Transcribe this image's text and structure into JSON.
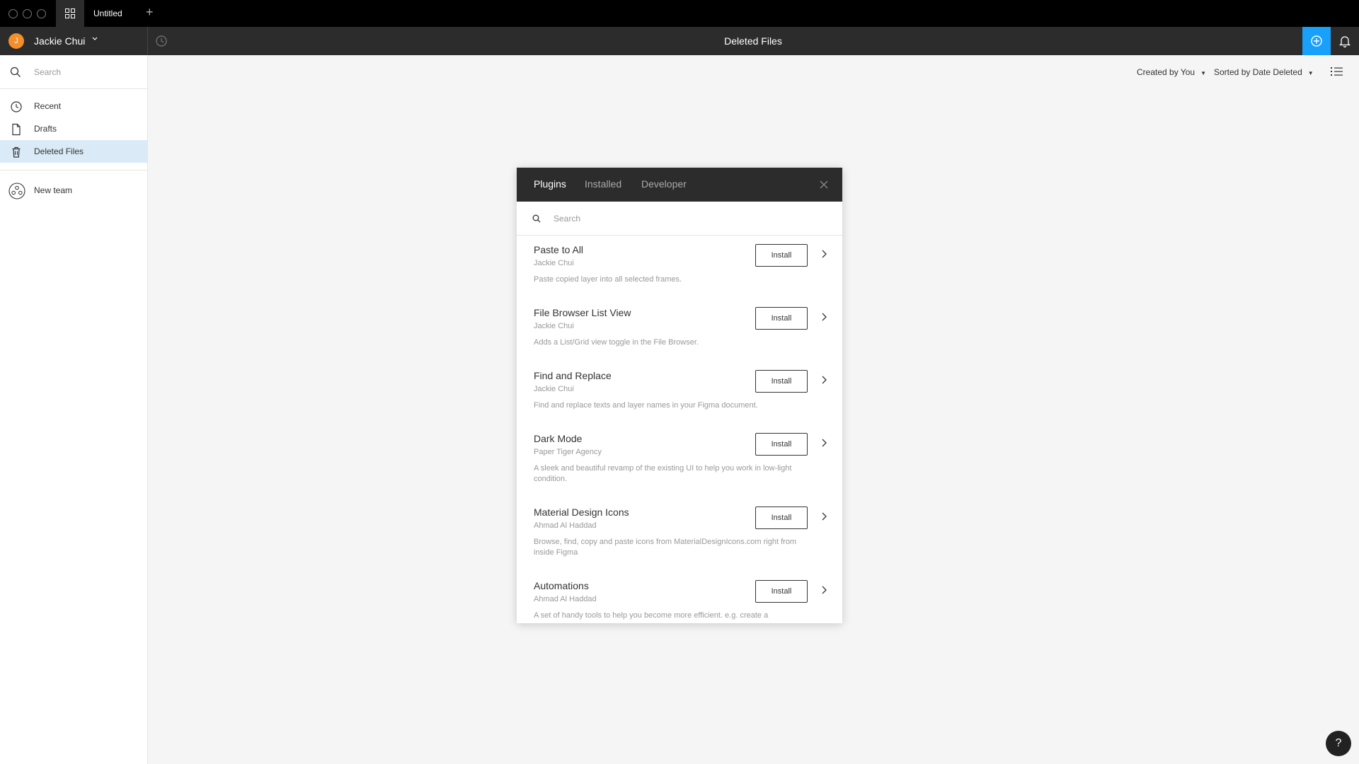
{
  "window": {
    "tab_title": "Untitled",
    "new_tab_symbol": "+"
  },
  "topbar": {
    "avatar_initial": "J",
    "user_name": "Jackie Chui",
    "page_title": "Deleted Files"
  },
  "sidebar": {
    "search_placeholder": "Search",
    "items": [
      {
        "label": "Recent",
        "icon": "clock-icon"
      },
      {
        "label": "Drafts",
        "icon": "file-icon"
      },
      {
        "label": "Deleted Files",
        "icon": "trash-icon",
        "active": true
      }
    ],
    "team": {
      "label": "New team",
      "icon": "team-icon"
    }
  },
  "filters": {
    "created_by": "Created by You",
    "sorted_by": "Sorted by Date Deleted"
  },
  "modal": {
    "tabs": [
      {
        "label": "Plugins",
        "active": true
      },
      {
        "label": "Installed"
      },
      {
        "label": "Developer"
      }
    ],
    "search_placeholder": "Search",
    "install_label": "Install",
    "plugins": [
      {
        "name": "Paste to All",
        "author": "Jackie Chui",
        "description": "Paste copied layer into all selected frames."
      },
      {
        "name": "File Browser List View",
        "author": "Jackie Chui",
        "description": "Adds a List/Grid view toggle in the File Browser."
      },
      {
        "name": "Find and Replace",
        "author": "Jackie Chui",
        "description": "Find and replace texts and layer names in your Figma document."
      },
      {
        "name": "Dark Mode",
        "author": "Paper Tiger Agency",
        "description": "A sleek and beautiful revamp of the existing UI to help you work in low-light condition."
      },
      {
        "name": "Material Design Icons",
        "author": "Ahmad Al Haddad",
        "description": "Browse, find, copy and paste icons from MaterialDesignIcons.com right from inside Figma"
      },
      {
        "name": "Automations",
        "author": "Ahmad Al Haddad",
        "description": "A set of handy tools to help you become more efficient. e.g. create a"
      }
    ]
  },
  "help": {
    "label": "?"
  },
  "colors": {
    "accent": "#18a0fb",
    "active_nav": "#daebf7",
    "avatar": "#f48e2c",
    "dark_bar": "#2c2c2c"
  }
}
